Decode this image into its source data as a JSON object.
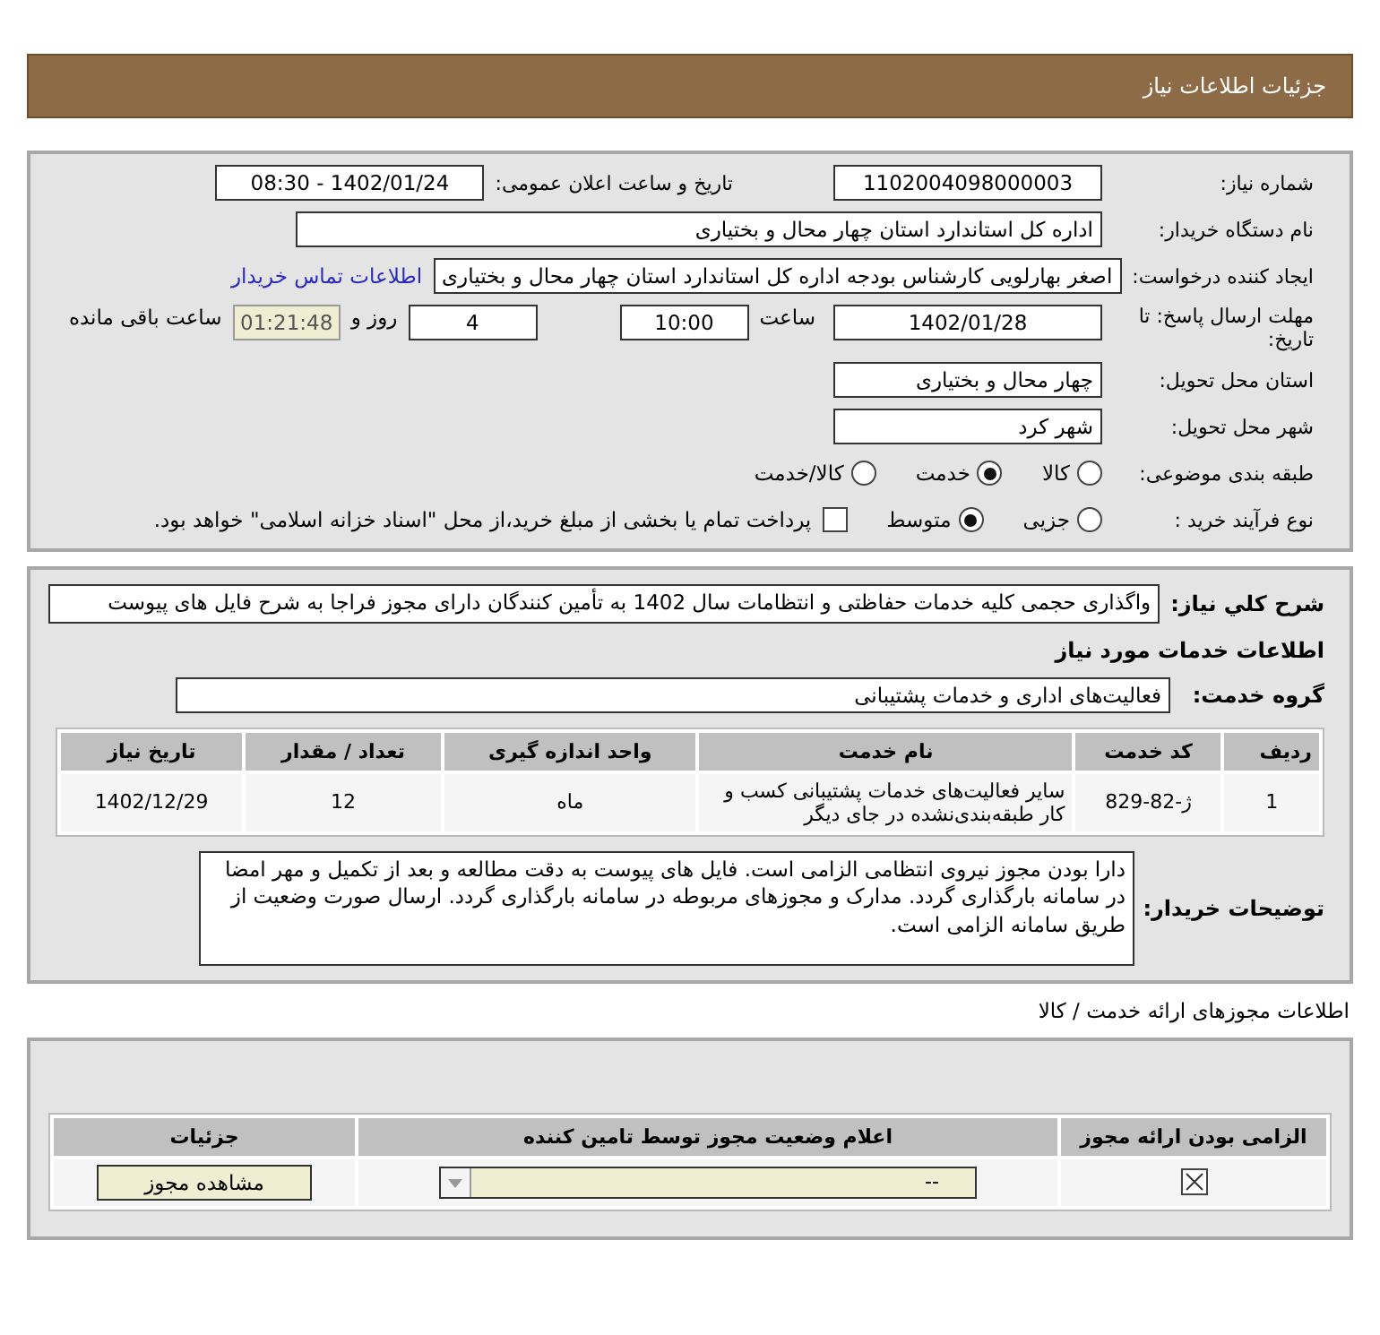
{
  "header": {
    "title": "جزئیات اطلاعات نیاز"
  },
  "need_number": {
    "label": "شماره نیاز:",
    "value": "1102004098000003"
  },
  "announce": {
    "label": "تاریخ و ساعت اعلان عمومی:",
    "value": "1402/01/24 - 08:30"
  },
  "buyer": {
    "label": "نام دستگاه خریدار:",
    "value": "اداره کل استاندارد استان چهار محال و بختیاری"
  },
  "requester": {
    "label": "ایجاد کننده درخواست:",
    "value": "اصغر بهارلویی  کارشناس بودجه اداره کل استاندارد استان چهار محال و بختیاری",
    "link": "اطلاعات تماس خریدار"
  },
  "deadline": {
    "label": "مهلت ارسال پاسخ: تا تاریخ:",
    "date": "1402/01/28",
    "time_label": "ساعت",
    "time": "10:00",
    "days": "4",
    "days_label": "روز و",
    "remaining": "01:21:48",
    "remaining_label": "ساعت باقی مانده"
  },
  "province": {
    "label": "استان محل تحویل:",
    "value": "چهار محال و بختیاری"
  },
  "city": {
    "label": "شهر محل تحویل:",
    "value": "شهر کرد"
  },
  "category": {
    "label": "طبقه بندی موضوعی:",
    "options": [
      {
        "label": "کالا",
        "selected": false
      },
      {
        "label": "خدمت",
        "selected": true
      },
      {
        "label": "کالا/خدمت",
        "selected": false
      }
    ]
  },
  "process": {
    "label": "نوع فرآیند خرید :",
    "options": [
      {
        "label": "جزیی",
        "selected": false
      },
      {
        "label": "متوسط",
        "selected": true
      }
    ],
    "payment": {
      "checked": false,
      "text": "پرداخت تمام یا بخشی از مبلغ خرید،از محل \"اسناد خزانه اسلامی\" خواهد بود."
    }
  },
  "summary": {
    "label": "شرح کلي نياز:",
    "value": "واگذاری حجمی کلیه خدمات حفاظتی و انتظامات سال 1402 به تأمین کنندگان دارای مجوز فراجا به شرح فایل های پیوست"
  },
  "services_heading": "اطلاعات خدمات مورد نیاز",
  "service_group": {
    "label": "گروه خدمت:",
    "value": "فعالیت‌های اداری و خدمات پشتیبانی"
  },
  "services_table": {
    "columns": [
      "ردیف",
      "کد خدمت",
      "نام خدمت",
      "واحد اندازه گیری",
      "تعداد / مقدار",
      "تاریخ نیاز"
    ],
    "rows": [
      [
        "1",
        "ژ-82-829",
        "سایر فعالیت‌های خدمات پشتیبانی کسب و کار طبقه‌بندی‌نشده در جای دیگر",
        "ماه",
        "12",
        "1402/12/29"
      ]
    ]
  },
  "buyer_notes": {
    "label": "توضیحات خریدار:",
    "value": "دارا بودن مجوز نیروی انتظامی الزامی است. فایل های پیوست به دقت مطالعه و بعد از تکمیل و مهر امضا در سامانه بارگذاری گردد. مدارک و مجوزهای مربوطه در سامانه بارگذاری گردد. ارسال صورت وضعیت از طریق سامانه الزامی است."
  },
  "permits": {
    "title": "اطلاعات مجوزهای ارائه خدمت / کالا",
    "columns": [
      "الزامی بودن ارائه مجوز",
      "اعلام وضعیت مجوز توسط تامین کننده",
      "جزئیات"
    ],
    "rows": [
      {
        "required": true,
        "status": "--",
        "button": "مشاهده مجوز"
      }
    ]
  }
}
